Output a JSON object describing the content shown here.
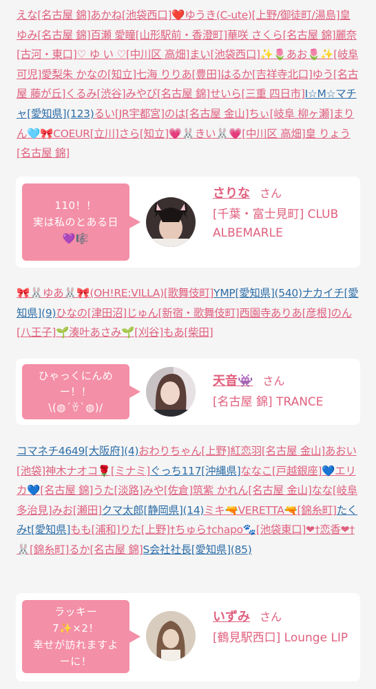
{
  "colors": {
    "pink": "#e0607e",
    "blue": "#2e6ea8",
    "bubble": "#f38fa6",
    "background": "#f5f5f5"
  },
  "section1": [
    {
      "t": "えな[名古屋 錦]",
      "c": "pink"
    },
    {
      "t": "あかね[池袋西口]",
      "c": "pink"
    },
    {
      "t": "❤️ゆうき(C-ute)[上野/御徒町/湯島]",
      "c": "pink"
    },
    {
      "t": "皇 ゆみ[名古屋 錦]",
      "c": "pink"
    },
    {
      "t": "百瀬 愛瞳[山形駅前・香澄町]",
      "c": "pink"
    },
    {
      "t": "華咲 さくら[名古屋 錦]",
      "c": "pink"
    },
    {
      "t": "麗奈[古河・東口]",
      "c": "pink"
    },
    {
      "t": "♡ ゆ い ♡[中川区 高畑]",
      "c": "pink"
    },
    {
      "t": "まい[池袋西口]",
      "c": "pink"
    },
    {
      "t": "✨🌷あお🌷✨[岐阜 可児]",
      "c": "pink"
    },
    {
      "t": "愛梨朱 かなの[知立]",
      "c": "pink"
    },
    {
      "t": "七海 りりあ[豊田]",
      "c": "pink"
    },
    {
      "t": "はるか[吉祥寺北口]",
      "c": "pink"
    },
    {
      "t": "ゆう[名古屋 藤が丘]",
      "c": "pink"
    },
    {
      "t": "くるみ[渋谷]",
      "c": "pink"
    },
    {
      "t": "みやび[名古屋 錦]",
      "c": "pink"
    },
    {
      "t": "せいら[三重 四日市]",
      "c": "pink"
    },
    {
      "t": "I☆M☆マチャ[愛知県](123)",
      "c": "blue"
    },
    {
      "t": "るい[JR宇都宮]",
      "c": "pink"
    },
    {
      "t": "のは[名古屋 金山]",
      "c": "pink"
    },
    {
      "t": "ちぃ[岐阜 柳ヶ瀬]",
      "c": "pink"
    },
    {
      "t": "まりん🩵🎀COEUR[立川]",
      "c": "pink"
    },
    {
      "t": "さら[知立]",
      "c": "pink"
    },
    {
      "t": "💗🐰きい🐰💗[中川区 高畑]",
      "c": "pink"
    },
    {
      "t": "皇 りょう[名古屋 錦]",
      "c": "pink"
    }
  ],
  "section2": [
    {
      "t": "🎀🐰ゆあ🐰🎀(OH!RE:VILLA)[歌舞伎町]",
      "c": "pink"
    },
    {
      "t": "YMP[愛知県](540)",
      "c": "blue"
    },
    {
      "t": "ナカイチ[愛知県](9)",
      "c": "blue"
    },
    {
      "t": "ひなの[津田沼]",
      "c": "pink"
    },
    {
      "t": "じゅん[新宿・歌舞伎町]",
      "c": "pink"
    },
    {
      "t": "西園寺ありあ[彦根]",
      "c": "pink"
    },
    {
      "t": "のん[八王子]",
      "c": "pink"
    },
    {
      "t": "🌱湊叶あさみ🌱[刈谷]",
      "c": "pink"
    },
    {
      "t": "もあ[柴田]",
      "c": "pink"
    }
  ],
  "section3": [
    {
      "t": "コマネチ4649[大阪府](4)",
      "c": "blue"
    },
    {
      "t": "おわりちゃん[上野]",
      "c": "pink"
    },
    {
      "t": "紅恋羽[名古屋 金山]",
      "c": "pink"
    },
    {
      "t": "あおい[池袋]",
      "c": "pink"
    },
    {
      "t": "神木ナオコ🌹[ミナミ]",
      "c": "pink"
    },
    {
      "t": "ぐっち117[沖縄県]",
      "c": "blue"
    },
    {
      "t": "ななこ[戸越銀座]",
      "c": "pink"
    },
    {
      "t": "💙エリカ💙[名古屋 錦]",
      "c": "pink"
    },
    {
      "t": "うた[淡路]",
      "c": "pink"
    },
    {
      "t": "みや[佐倉]",
      "c": "pink"
    },
    {
      "t": "筑紫 かれん[名古屋 金山]",
      "c": "pink"
    },
    {
      "t": "なな[岐阜 多治見]",
      "c": "pink"
    },
    {
      "t": "みお[瀬田]",
      "c": "pink"
    },
    {
      "t": "クマ太郎[静岡県](14)",
      "c": "blue"
    },
    {
      "t": "ミキ🔫VERETTA🔫[錦糸町]",
      "c": "pink"
    },
    {
      "t": "たくみt[愛知県]",
      "c": "blue"
    },
    {
      "t": "もも[浦和]",
      "c": "pink"
    },
    {
      "t": "りた[上野]",
      "c": "pink"
    },
    {
      "t": "†ちゅら†chapo🐾[池袋東口]",
      "c": "pink"
    },
    {
      "t": "❤†恋香❤†🐰[錦糸町]",
      "c": "pink"
    },
    {
      "t": "るか[名古屋 錦]",
      "c": "pink"
    },
    {
      "t": "S会社社長[愛知県](85)",
      "c": "blue"
    }
  ],
  "cards": [
    {
      "bubble_lines": [
        "110！！",
        "実は私のとある日",
        "💜🎼"
      ],
      "name": "さりな",
      "san": "さん",
      "shop": "[千葉・富士見町] CLUB ALBEMARLE"
    },
    {
      "bubble_lines": [
        "ひゃっくにんめ",
        "ー！！",
        "\\(◍´ꈊ`◍)/"
      ],
      "name": "天音👾",
      "san": "さん",
      "shop": "[名古屋 錦] TRANCE"
    },
    {
      "bubble_lines": [
        "ラッキー",
        "7✨×2！",
        "幸せが訪れますよ",
        "ーに！"
      ],
      "name": "いずみ",
      "san": "さん",
      "shop": "[鶴見駅西口] Lounge LIP"
    }
  ]
}
